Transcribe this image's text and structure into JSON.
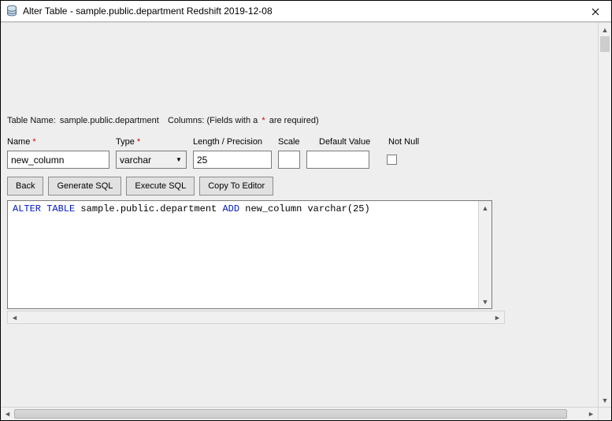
{
  "window": {
    "title": "Alter Table - sample.public.department Redshift 2019-12-08"
  },
  "info": {
    "table_label": "Table Name:",
    "table_value": "sample.public.department",
    "columns_label": "Columns: (Fields with a",
    "columns_tail": "are required)"
  },
  "labels": {
    "name": "Name",
    "type": "Type",
    "length": "Length / Precision",
    "scale": "Scale",
    "default": "Default Value",
    "notnull": "Not Null"
  },
  "values": {
    "name": "new_column",
    "type": "varchar",
    "length": "25",
    "scale": "",
    "default": ""
  },
  "buttons": {
    "back": "Back",
    "generate": "Generate SQL",
    "execute": "Execute SQL",
    "copy": "Copy To Editor"
  },
  "sql": {
    "kw1": "ALTER TABLE",
    "mid": " sample.public.department ",
    "kw2": "ADD",
    "tail": " new_column varchar(25)"
  }
}
